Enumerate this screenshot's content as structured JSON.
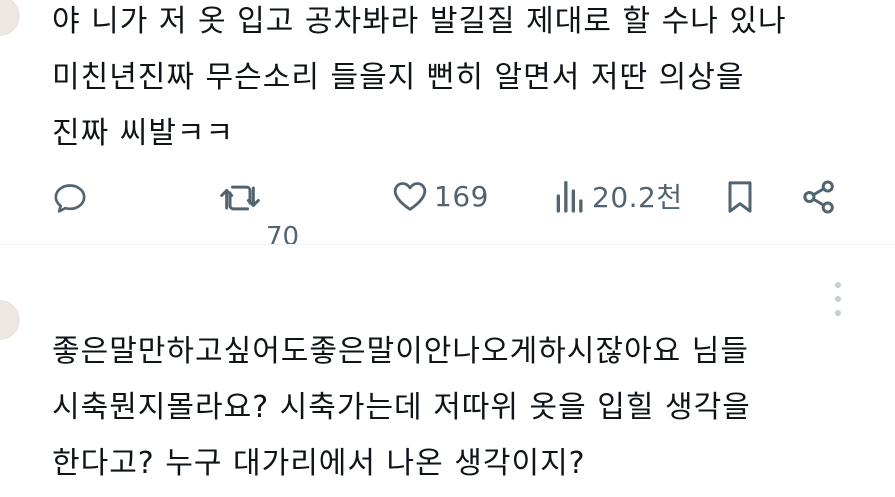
{
  "tweet1": {
    "text": "야 니가 저 옷 입고 공차봐라 발길질 제대로 할 수나 있나\n미친년진짜 무슨소리 들을지 뻔히 알면서 저딴 의상을\n진짜 씨발ㅋㅋ"
  },
  "actions": {
    "reply_icon": "reply-icon",
    "retweet_icon": "retweet-icon",
    "retweet_count": "70",
    "like_icon": "heart-icon",
    "like_count": "169",
    "views_icon": "views-icon",
    "views_count": "20.2천",
    "bookmark_icon": "bookmark-icon",
    "share_icon": "share-icon"
  },
  "tweet2": {
    "text": "좋은말만하고싶어도좋은말이안나오게하시잖아요 님들\n시축뭔지몰라요? 시축가는데 저따위 옷을 입힐 생각을\n한다고? 누구 대가리에서 나온 생각이지?"
  },
  "colors": {
    "text": "#0f1419",
    "icon": "#536471",
    "divider": "#eff3f4",
    "avatar": "#ece7e2"
  }
}
